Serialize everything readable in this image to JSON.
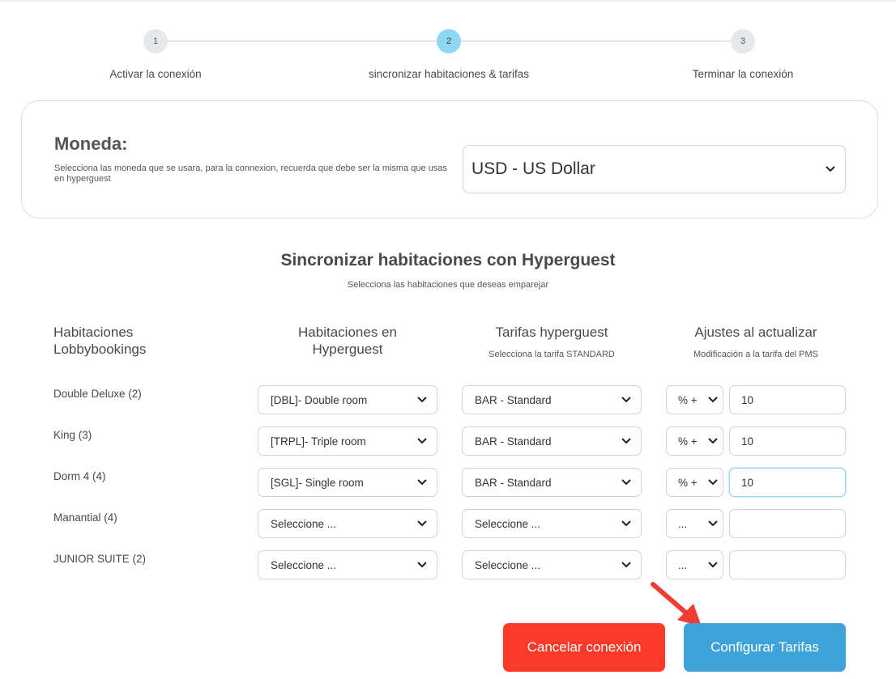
{
  "stepper": {
    "steps": [
      {
        "number": "1",
        "label": "Activar la conexión"
      },
      {
        "number": "2",
        "label": "sincronizar habitaciones & tarifas"
      },
      {
        "number": "3",
        "label": "Terminar la conexión"
      }
    ],
    "active_step": 2
  },
  "currency": {
    "title": "Moneda:",
    "description": "Selecciona las moneda que se usara, para la connexion, recuerda que debe ser la misma que usas en hyperguest",
    "selected": "USD - US Dollar"
  },
  "sync": {
    "title": "Sincronizar habitaciones con Hyperguest",
    "subtitle": "Selecciona las habitaciones que deseas emparejar",
    "columns": {
      "lobby": "Habitaciones Lobbybookings",
      "hyperguest": "Habitaciones en Hyperguest",
      "rates": "Tarifas hyperguest",
      "rates_sub": "Selecciona la tarifa STANDARD",
      "adjust": "Ajustes al actualizar",
      "adjust_sub": "Modificación a la tarifa del PMS"
    },
    "rows": [
      {
        "room": "Double Deluxe (2)",
        "hyperguest_room": "[DBL]- Double room",
        "rate": "BAR - Standard",
        "modifier": "% +",
        "value": "10"
      },
      {
        "room": "King (3)",
        "hyperguest_room": "[TRPL]- Triple room",
        "rate": "BAR - Standard",
        "modifier": "% +",
        "value": "10"
      },
      {
        "room": "Dorm 4 (4)",
        "hyperguest_room": "[SGL]- Single room",
        "rate": "BAR - Standard",
        "modifier": "% +",
        "value": "10"
      },
      {
        "room": "Manantial (4)",
        "hyperguest_room": "Seleccione ...",
        "rate": "Seleccione ...",
        "modifier": "...",
        "value": ""
      },
      {
        "room": "JUNIOR SUITE (2)",
        "hyperguest_room": "Seleccione ...",
        "rate": "Seleccione ...",
        "modifier": "...",
        "value": ""
      }
    ]
  },
  "buttons": {
    "cancel": "Cancelar conexión",
    "configure": "Configurar Tarifas"
  },
  "colors": {
    "cancel": "#fc3a2a",
    "configure": "#3ea3d9",
    "active_step": "#8fd8f3",
    "annotation_arrow": "#f03c32"
  }
}
